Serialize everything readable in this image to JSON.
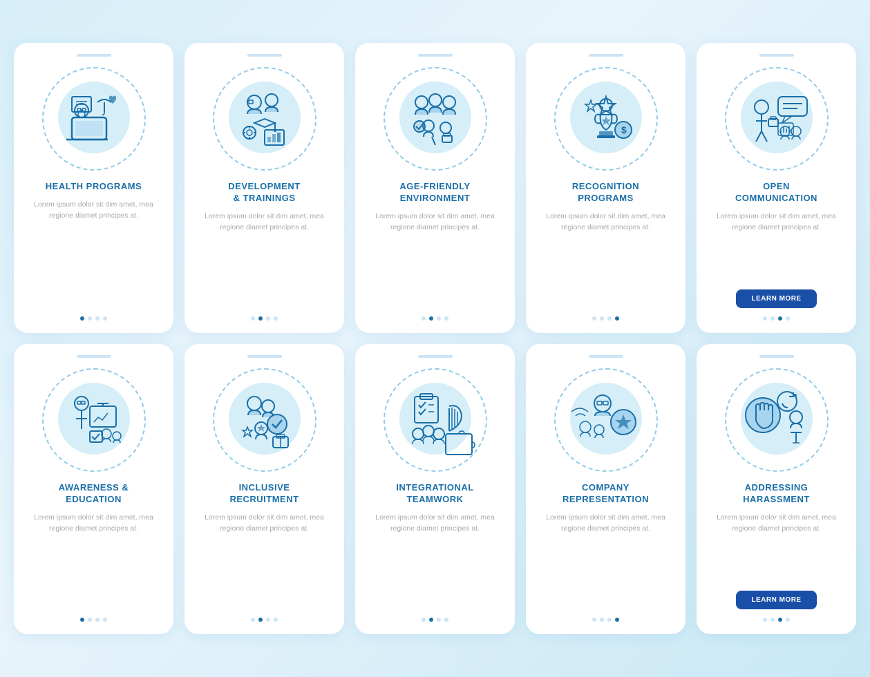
{
  "cards": [
    {
      "id": "health-programs",
      "title": "HEALTH PROGRAMS",
      "body": "Lorem ipsum dolor sit dim amet, mea regione diamet principes at.",
      "dots": [
        true,
        false,
        false,
        false
      ],
      "hasButton": false,
      "icon": "health"
    },
    {
      "id": "development-trainings",
      "title": "DEVELOPMENT\n& TRAININGS",
      "body": "Lorem ipsum dolor sit dim amet, mea regione diamet principes at.",
      "dots": [
        false,
        true,
        false,
        false
      ],
      "hasButton": false,
      "icon": "development"
    },
    {
      "id": "age-friendly-environment",
      "title": "AGE-FRIENDLY\nENVIRONMENT",
      "body": "Lorem ipsum dolor sit dim amet, mea regione diamet principes at.",
      "dots": [
        false,
        true,
        false,
        false
      ],
      "hasButton": false,
      "icon": "agefriendly"
    },
    {
      "id": "recognition-programs",
      "title": "RECOGNITION\nPROGRAMS",
      "body": "Lorem ipsum dolor sit dim amet, mea regione diamet principes at.",
      "dots": [
        false,
        false,
        false,
        true
      ],
      "hasButton": false,
      "icon": "recognition"
    },
    {
      "id": "open-communication",
      "title": "OPEN\nCOMMUNICATION",
      "body": "Lorem ipsum dolor sit dim amet, mea regione diamet principes at.",
      "dots": [
        false,
        false,
        true,
        false
      ],
      "hasButton": true,
      "buttonLabel": "LEARN MORE",
      "icon": "communication"
    },
    {
      "id": "awareness-education",
      "title": "AWARENESS &\nEDUCATION",
      "body": "Lorem ipsum dolor sit dim amet, mea regione diamet principes at.",
      "dots": [
        true,
        false,
        false,
        false
      ],
      "hasButton": false,
      "icon": "awareness"
    },
    {
      "id": "inclusive-recruitment",
      "title": "INCLUSIVE\nRECRUITMENT",
      "body": "Lorem ipsum dolor sit dim amet, mea regione diamet principes at.",
      "dots": [
        false,
        true,
        false,
        false
      ],
      "hasButton": false,
      "icon": "inclusive"
    },
    {
      "id": "integrational-teamwork",
      "title": "INTEGRATIONAL\nTEAMWORK",
      "body": "Lorem ipsum dolor sit dim amet, mea regione diamet principes at.",
      "dots": [
        false,
        true,
        false,
        false
      ],
      "hasButton": false,
      "icon": "teamwork"
    },
    {
      "id": "company-representation",
      "title": "COMPANY\nREPRESENTATION",
      "body": "Lorem ipsum dolor sit dim amet, mea regione diamet principes at.",
      "dots": [
        false,
        false,
        false,
        true
      ],
      "hasButton": false,
      "icon": "company"
    },
    {
      "id": "addressing-harassment",
      "title": "ADDRESSING\nHARASSMENT",
      "body": "Lorem ipsum dolor sit dim amet, mea regione diamet principes at.",
      "dots": [
        false,
        false,
        true,
        false
      ],
      "hasButton": true,
      "buttonLabel": "LEARN MORE",
      "icon": "harassment"
    }
  ]
}
